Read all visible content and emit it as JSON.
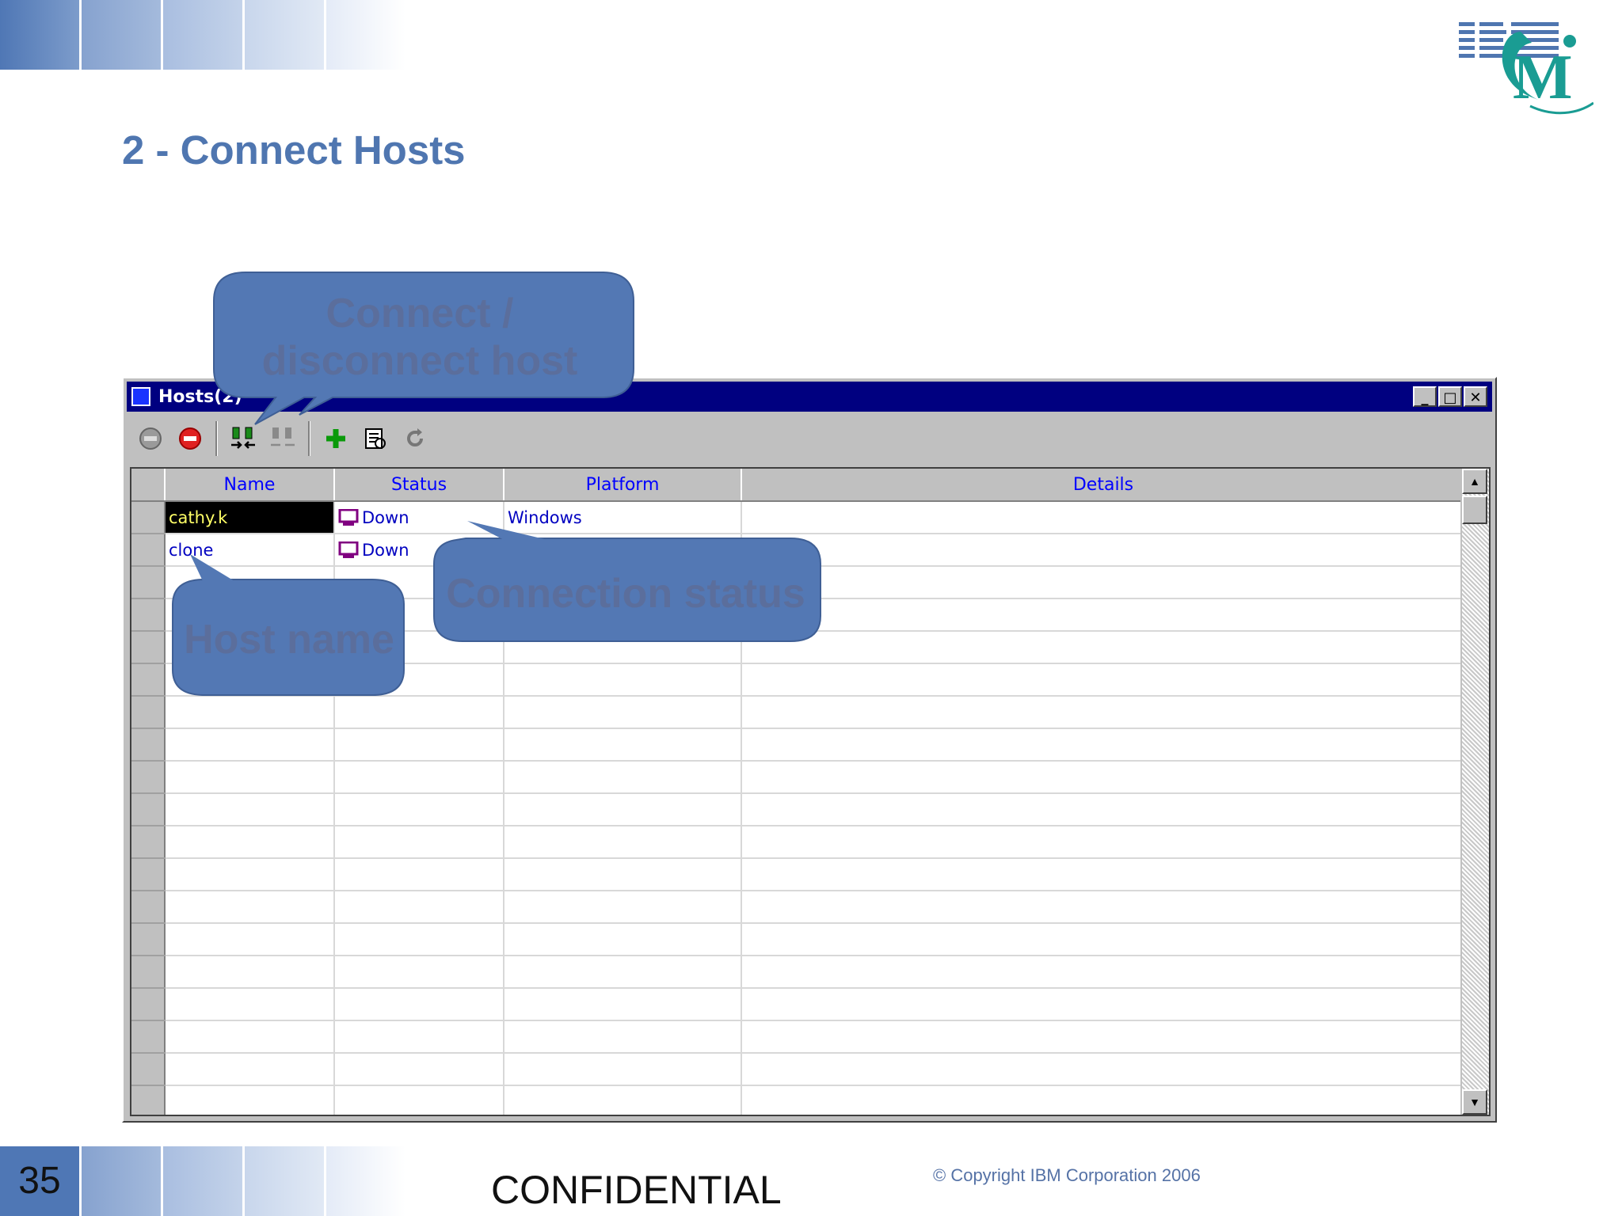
{
  "slide": {
    "title": "2 - Connect Hosts",
    "number": "35",
    "footer_confidential": "CONFIDENTIAL",
    "footer_copyright": "© Copyright IBM Corporation 2006",
    "logo": "IBM CM logo"
  },
  "window": {
    "title": "Hosts(2)",
    "controls": {
      "minimize": "_",
      "maximize": "□",
      "close": "✕"
    },
    "toolbar": [
      {
        "icon": "stop-gray-icon"
      },
      {
        "icon": "stop-red-icon"
      },
      {
        "icon": "connect-host-icon"
      },
      {
        "icon": "disconnect-host-icon"
      },
      {
        "icon": "add-icon"
      },
      {
        "icon": "properties-icon"
      },
      {
        "icon": "refresh-icon"
      }
    ]
  },
  "grid": {
    "columns": [
      "Name",
      "Status",
      "Platform",
      "Details"
    ],
    "rows": [
      {
        "name": "cathy.k",
        "status": "Down",
        "platform": "Windows",
        "details": ""
      },
      {
        "name": "clone",
        "status": "Down",
        "platform": "",
        "details": ""
      }
    ]
  },
  "callouts": {
    "connect": "Connect / disconnect host",
    "status": "Connection status",
    "name": "Host name"
  },
  "colors": {
    "title": "#4f76b0",
    "callout_fill": "#5378b4",
    "titlebar": "#000080",
    "header_text": "#0000ff"
  }
}
